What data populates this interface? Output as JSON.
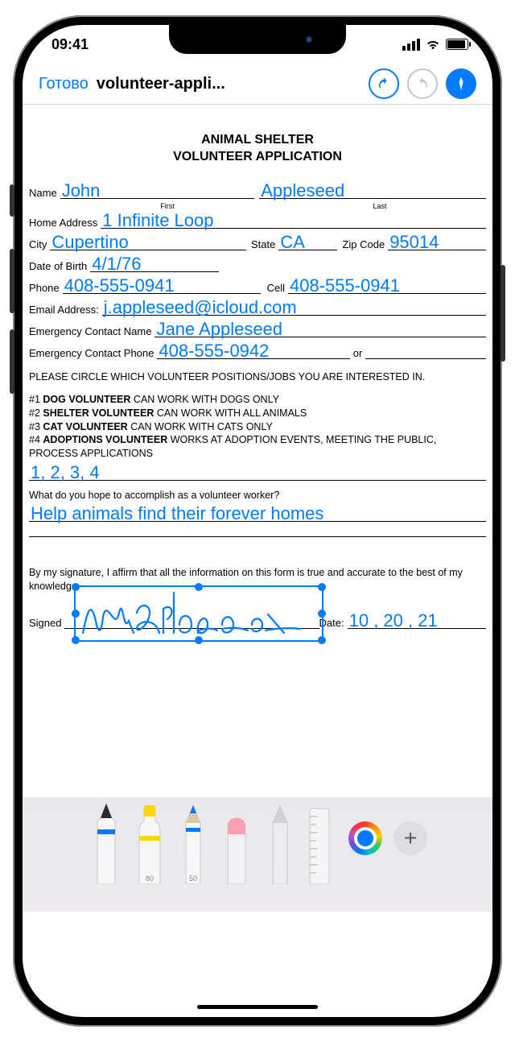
{
  "status": {
    "time": "09:41"
  },
  "nav": {
    "done_label": "Готово",
    "title": "volunteer-appli..."
  },
  "doc": {
    "header_line1": "ANIMAL SHELTER",
    "header_line2": "VOLUNTEER APPLICATION",
    "labels": {
      "name": "Name",
      "first": "First",
      "last": "Last",
      "home_address": "Home Address",
      "city": "City",
      "state": "State",
      "zip": "Zip Code",
      "dob": "Date of Birth",
      "phone": "Phone",
      "cell": "Cell",
      "email": "Email Address:",
      "ec_name": "Emergency Contact Name",
      "ec_phone": "Emergency Contact Phone",
      "or": "or",
      "signed": "Signed",
      "date": "Date:"
    },
    "values": {
      "first_name": "John",
      "last_name": "Appleseed",
      "home_address": "1 Infinite Loop",
      "city": "Cupertino",
      "state": "CA",
      "zip": "95014",
      "dob": "4/1/76",
      "phone": "408-555-0941",
      "cell": "408-555-0941",
      "email": "j.appleseed@icloud.com",
      "ec_name": "Jane Appleseed",
      "ec_phone": "408-555-0942",
      "positions_choice": "1, 2, 3, 4",
      "accomplish": "Help animals find their forever homes",
      "sig_date": "10 , 20 , 21"
    },
    "sections": {
      "positions_intro": "PLEASE CIRCLE WHICH VOLUNTEER POSITIONS/JOBS YOU ARE INTERESTED IN.",
      "pos1_num": "#1 ",
      "pos1_b": "DOG VOLUNTEER",
      "pos1_t": " CAN WORK WITH DOGS ONLY",
      "pos2_num": "#2 ",
      "pos2_b": "SHELTER VOLUNTEER",
      "pos2_t": " CAN WORK WITH ALL ANIMALS",
      "pos3_num": "#3 ",
      "pos3_b": "CAT VOLUNTEER",
      "pos3_t": " CAN WORK WITH CATS ONLY",
      "pos4_num": "#4 ",
      "pos4_b": "ADOPTIONS VOLUNTEER",
      "pos4_t": " WORKS AT ADOPTION EVENTS, MEETING THE PUBLIC, PROCESS APPLICATIONS",
      "accomplish_q": "What do you hope to accomplish as a volunteer worker?",
      "affirm": "By my signature, I affirm that all the information on this form is true and accurate to the best of my knowledge."
    }
  },
  "tools": {
    "pen_label": "",
    "highlighter_val": "80",
    "pencil_val": "50"
  }
}
